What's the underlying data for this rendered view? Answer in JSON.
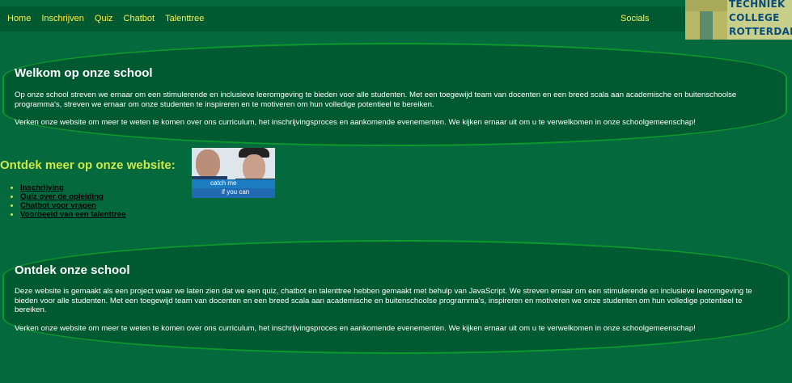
{
  "nav": {
    "items": [
      {
        "label": "Home"
      },
      {
        "label": "Inschrijven"
      },
      {
        "label": "Quiz"
      },
      {
        "label": "Chatbot"
      },
      {
        "label": "Talenttree"
      }
    ],
    "socials": "Socials"
  },
  "logo": {
    "line1": "TECHNIEK",
    "line2": "COLLEGE",
    "line3": "ROTTERDAM"
  },
  "hero": {
    "title": "Welkom op onze school",
    "p1": "Op onze school streven we ernaar om een stimulerende en inclusieve leeromgeving te bieden voor alle studenten. Met een toegewijd team van docenten en een breed scala aan academische en buitenschoolse programma's, streven we ernaar om onze studenten te inspireren en te motiveren om hun volledige potentieel te bereiken.",
    "p2": "Verken onze website om meer te weten te komen over ons curriculum, het inschrijvingsproces en aankomende evenementen. We kijken ernaar uit om u te verwelkomen in onze schoolgemeenschap!"
  },
  "explore": {
    "title": "Ontdek meer op onze website:",
    "links": [
      {
        "label": "Inschrijving"
      },
      {
        "label": "Quiz over de opleiding"
      },
      {
        "label": "Chatbot voor vragen"
      },
      {
        "label": "Voorbeeld van een talenttree"
      }
    ]
  },
  "movie_image": {
    "line1": "catch me",
    "line2": "if you can"
  },
  "discover": {
    "title": "Ontdek onze school",
    "p1": "Deze website is gemaakt als een project waar we laten zien dat we een quiz, chatbot en talenttree hebben gemaakt met behulp van JavaScript. We streven ernaar om een stimulerende en inclusieve leeromgeving te bieden voor alle studenten. Met een toegewijd team van docenten en een breed scala aan academische en buitenschoolse programma's, inspireren en motiveren we onze studenten om hun volledige potentieel te bereiken.",
    "p2": "Verken onze website om meer te weten te komen over ons curriculum, het inschrijvingsproces en aankomende evenementen. We kijken ernaar uit om u te verwelkomen in onze schoolgemeenschap!"
  },
  "colors": {
    "background": "#046a3e",
    "panel": "#005a31",
    "panel_border": "#0c9a2c",
    "nav_link": "#ffef4a",
    "accent_title": "#cde84a"
  }
}
